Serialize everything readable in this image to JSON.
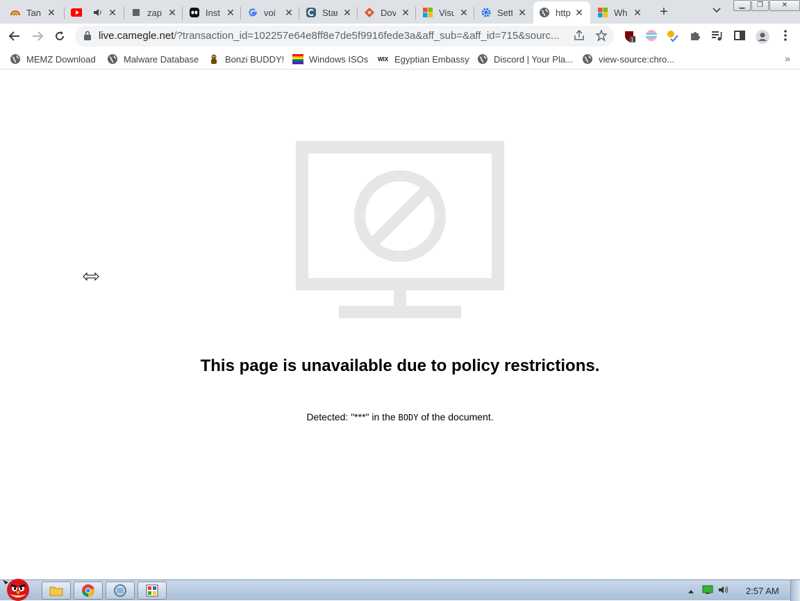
{
  "tabs": [
    {
      "title": "Tan",
      "icon": "rainbow-icon"
    },
    {
      "title": "",
      "icon": "youtube-icon",
      "audio": true
    },
    {
      "title": "zap",
      "icon": "square-icon"
    },
    {
      "title": "Inst",
      "icon": "alien-icon"
    },
    {
      "title": "voi",
      "icon": "google-icon"
    },
    {
      "title": "Star",
      "icon": "starbuck-icon"
    },
    {
      "title": "Dov",
      "icon": "diamond-icon"
    },
    {
      "title": "Visu",
      "icon": "windows-icon"
    },
    {
      "title": "Sett",
      "icon": "gear-icon"
    },
    {
      "title": "http",
      "icon": "globe-icon",
      "active": true
    },
    {
      "title": "Wh",
      "icon": "windows-icon"
    }
  ],
  "address": {
    "host": "live.camegle.net",
    "path": "/?transaction_id=102257e64e8ff8e7de5f9916fede3a&aff_sub=&aff_id=715&sourc..."
  },
  "bookmarks": [
    {
      "label": "MEMZ Download",
      "icon": "globe-icon"
    },
    {
      "label": "Malware Database",
      "icon": "globe-icon"
    },
    {
      "label": "Bonzi BUDDY!",
      "icon": "bonzi-icon"
    },
    {
      "label": "Windows ISOs",
      "icon": "rainbow-flag-icon"
    },
    {
      "label": "Egyptian Embassy",
      "icon": "wix-icon"
    },
    {
      "label": "Discord | Your Pla...",
      "icon": "globe-icon"
    },
    {
      "label": "view-source:chro...",
      "icon": "globe-icon"
    }
  ],
  "page": {
    "heading": "This page is unavailable due to policy restrictions.",
    "detected_prefix": "Detected: \"",
    "detected_term": "***",
    "detected_mid": "\" in the ",
    "detected_section": "BODY",
    "detected_suffix": " of the document."
  },
  "taskbar": {
    "clock": "2:57 AM"
  },
  "colors": {
    "blocked_art": "#e6e6e6",
    "tabstrip": "#dee1e6"
  }
}
